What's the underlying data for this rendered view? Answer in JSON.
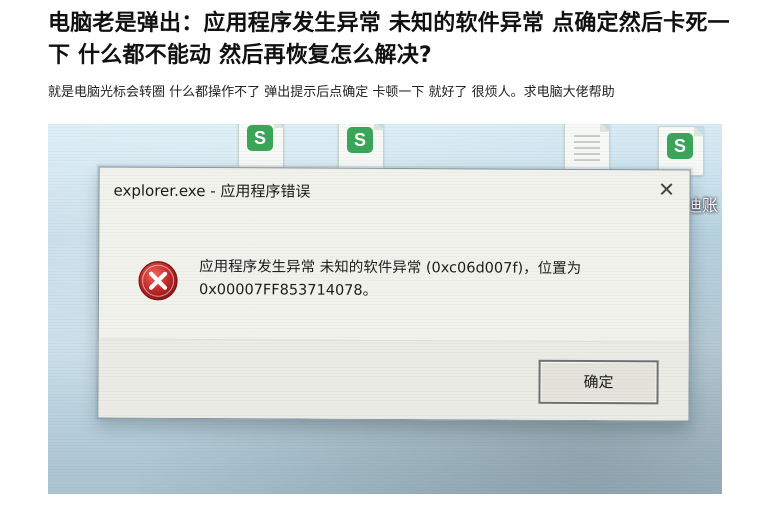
{
  "post": {
    "title": "电脑老是弹出：应用程序发生异常 未知的软件异常 点确定然后卡死一下 什么都不能动 然后再恢复怎么解决?",
    "body": "就是电脑光标会转圈 什么都操作不了 弹出提示后点确定 卡顿一下 就好了 很烦人。求电脑大佬帮助"
  },
  "screenshot": {
    "desktop_icons": [
      {
        "name": "spreadsheet-file-icon",
        "badge": "S"
      },
      {
        "name": "spreadsheet-file-icon",
        "badge": "S"
      },
      {
        "name": "document-file-icon",
        "badge": ""
      },
      {
        "name": "spreadsheet-file-icon",
        "badge": "S"
      }
    ],
    "desktop_label_partial": "迪账",
    "dialog": {
      "title": "explorer.exe - 应用程序错误",
      "message_line1": "应用程序发生异常 未知的软件异常 (0xc06d007f)，位置为",
      "message_line2": "0x00007FF853714078。",
      "ok_label": "确定",
      "close_glyph": "✕",
      "icon": "error-icon"
    }
  },
  "colors": {
    "error_red": "#c62828",
    "spreadsheet_green": "#3ba55a",
    "dialog_bg": "#f2f2ed",
    "button_border": "#6f7175"
  }
}
